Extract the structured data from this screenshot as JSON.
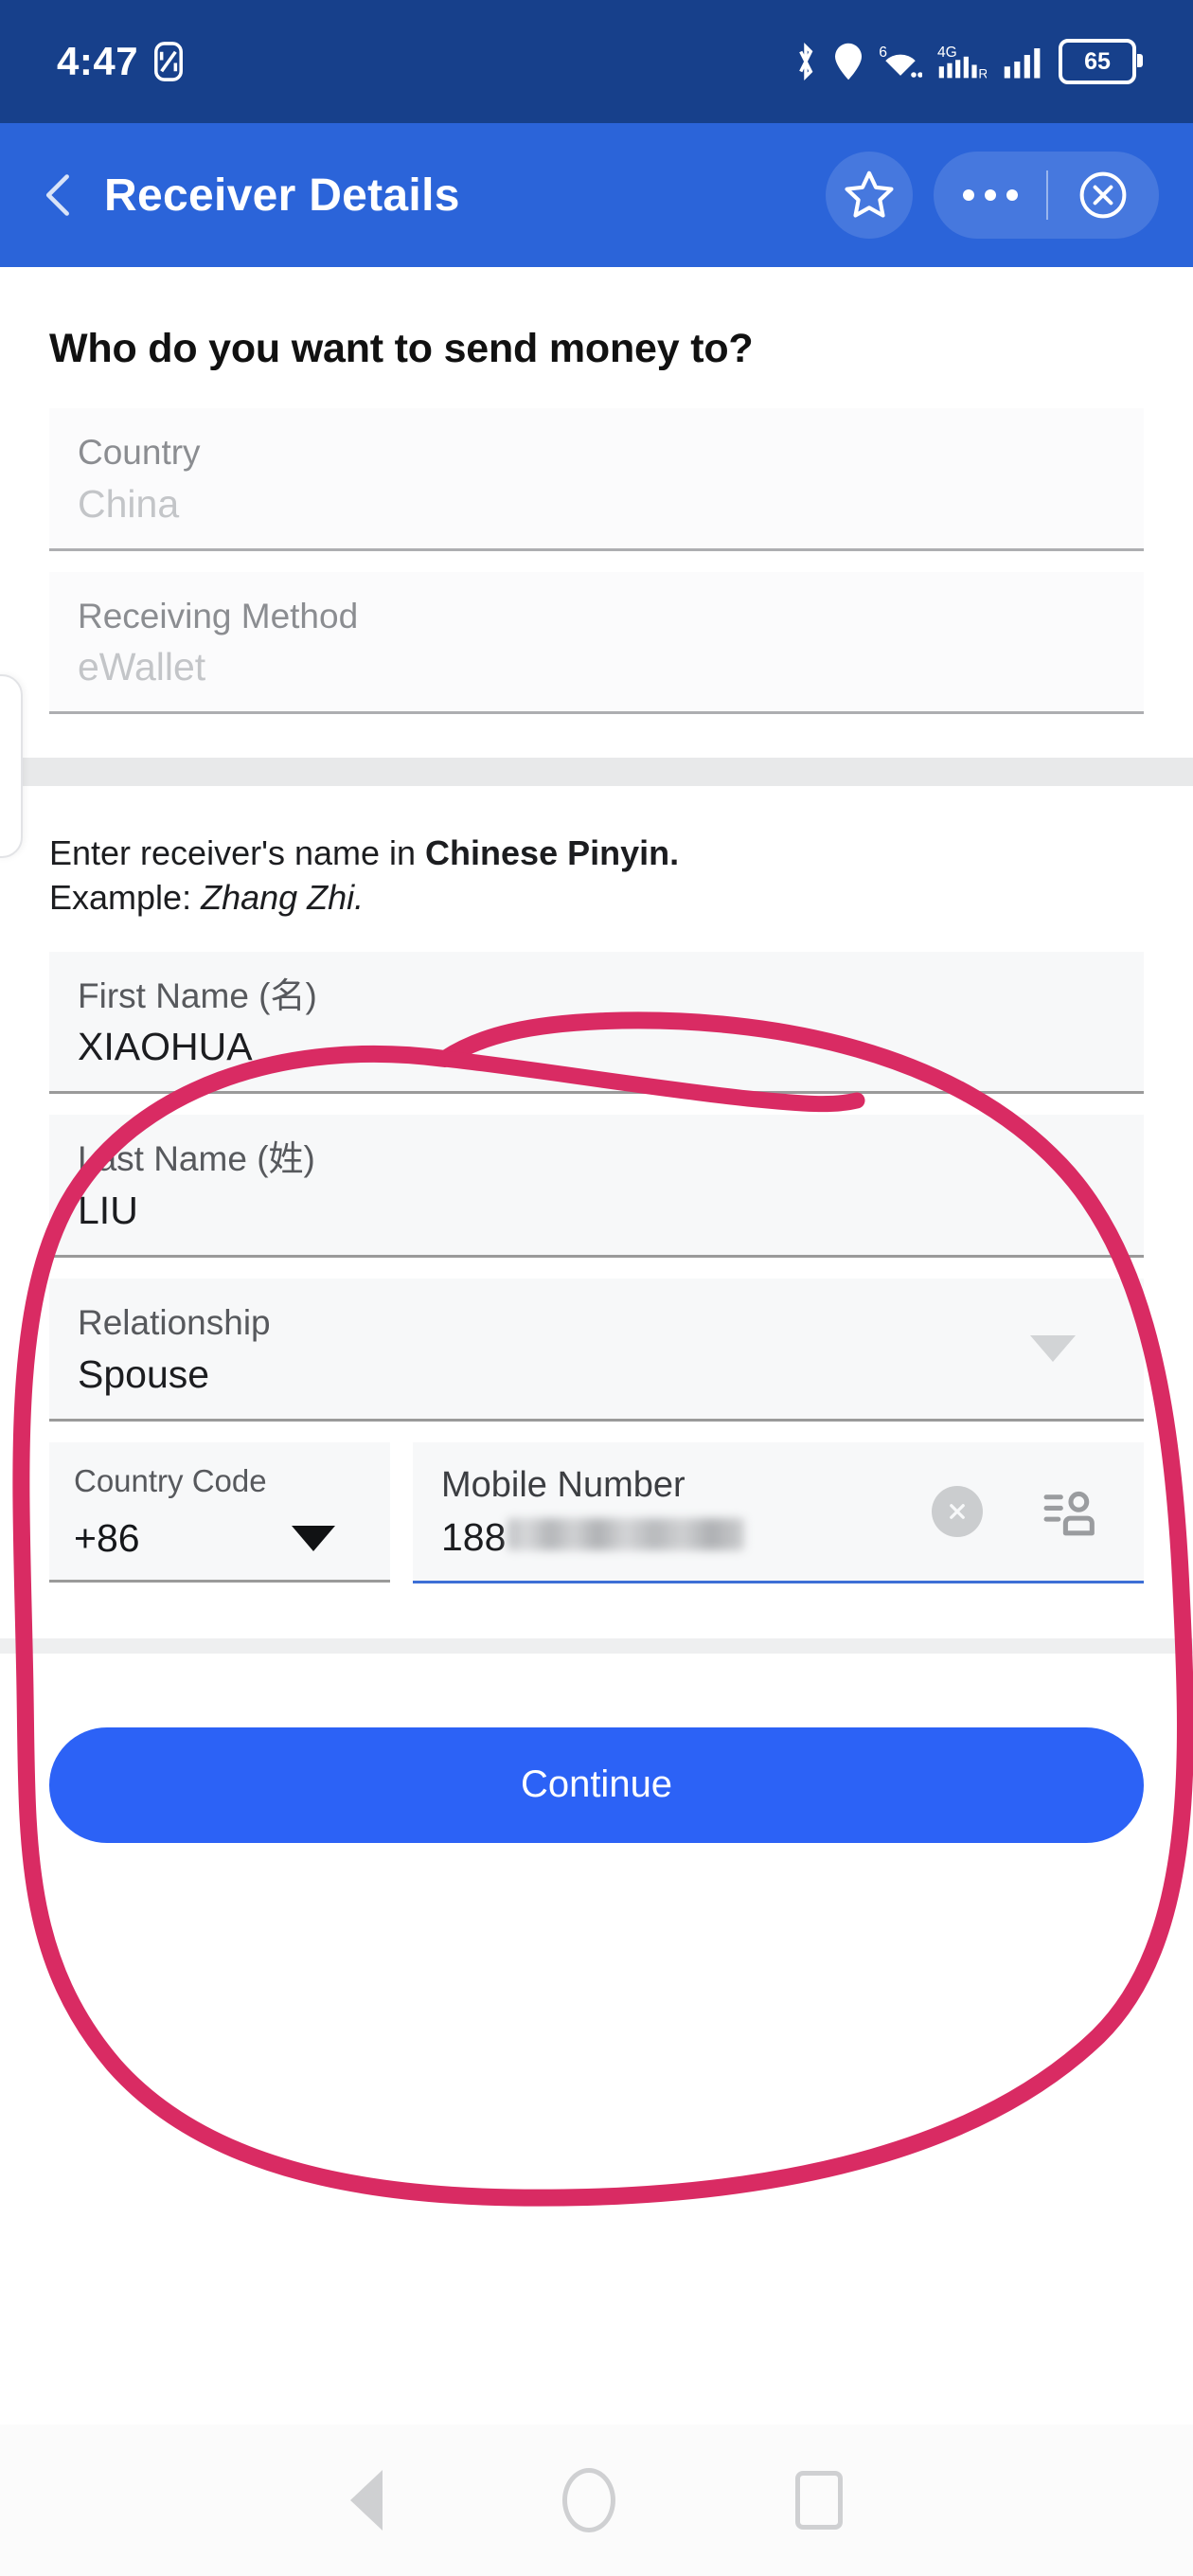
{
  "status_bar": {
    "time": "4:47",
    "nfc_icon": "nfc-icon",
    "bluetooth_icon": "bluetooth-icon",
    "location_icon": "location-pin-icon",
    "wifi_icon": "wifi-6-icon",
    "wifi_badge": "6",
    "mobile_data_icon": "4g-signal-icon",
    "mobile_data_badge": "4G",
    "signal_icon": "cellular-signal-icon",
    "battery_level": "65"
  },
  "header": {
    "back_icon": "back-chevron-icon",
    "title": "Receiver Details",
    "favorite_icon": "star-icon",
    "more_icon": "more-options-icon",
    "close_icon": "close-circle-icon"
  },
  "main": {
    "headline": "Who do you want to send money to?",
    "transfer_fields": [
      {
        "label": "Country",
        "value": "China"
      },
      {
        "label": "Receiving Method",
        "value": "eWallet"
      }
    ],
    "hint": {
      "line1_plain": "Enter receiver's name in ",
      "line1_bold": "Chinese Pinyin.",
      "line2_plain": "Example: ",
      "line2_italic": "Zhang Zhi."
    },
    "name_fields": [
      {
        "label": "First Name (名)",
        "value": "XIAOHUA"
      },
      {
        "label": "Last Name (姓)",
        "value": "LIU"
      }
    ],
    "relationship": {
      "label": "Relationship",
      "value": "Spouse",
      "caret_icon": "chevron-down-icon"
    },
    "country_code": {
      "label": "Country Code",
      "value": "+86",
      "caret_icon": "chevron-down-icon"
    },
    "mobile_number": {
      "label": "Mobile Number",
      "value": "188",
      "redacted": true,
      "clear_icon": "clear-circle-icon",
      "contacts_icon": "contacts-picker-icon"
    },
    "cta_label": "Continue"
  },
  "annotation": {
    "shape": "hand-drawn-circle",
    "color": "#D92B63"
  },
  "nav_bar": {
    "back_icon": "nav-back-icon",
    "home_icon": "nav-home-icon",
    "recents_icon": "nav-recents-icon"
  },
  "colors": {
    "status_bar_bg": "#17408B",
    "app_bar_bg": "#2B64D9",
    "cta_bg": "#2C62F6",
    "field_bg": "#F7F8F9",
    "focus_underline": "#3D6FD6",
    "annotation": "#D92B63"
  }
}
